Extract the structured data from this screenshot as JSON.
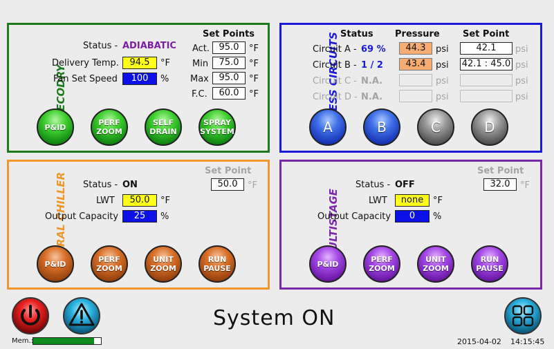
{
  "ecodry": {
    "title": "ECODRY",
    "status_label": "Status -",
    "status_value": "ADIABATIC",
    "set_points_header": "Set Points",
    "delivery_temp_label": "Delivery Temp.",
    "delivery_temp_value": "94.5",
    "fan_set_speed_label": "Fan Set Speed",
    "fan_set_speed_value": "100",
    "unit_f": "°F",
    "unit_pct": "%",
    "sp_act_label": "Act.",
    "sp_act_value": "95.0",
    "sp_min_label": "Min",
    "sp_min_value": "75.0",
    "sp_max_label": "Max",
    "sp_max_value": "95.0",
    "sp_fc_label": "F.C.",
    "sp_fc_value": "60.0",
    "buttons": [
      "P&ID",
      "PERF ZOOM",
      "SELF DRAIN",
      "SPRAY SYSTEM"
    ]
  },
  "process": {
    "title": "PROCESS CIRCUITS",
    "status_header": "Status",
    "pressure_header": "Pressure",
    "setpoint_header": "Set Point",
    "unit_psi": "psi",
    "circuits": [
      {
        "label": "Circuit A -",
        "status": "69 %",
        "pressure": "44.3",
        "setpoint": "42.1"
      },
      {
        "label": "Circuit B -",
        "status": "1 / 2",
        "pressure": "43.4",
        "setpoint": "42.1 : 45.0"
      },
      {
        "label": "Circuit C -",
        "status": "N.A.",
        "pressure": "",
        "setpoint": ""
      },
      {
        "label": "Circuit D -",
        "status": "N.A.",
        "pressure": "",
        "setpoint": ""
      }
    ],
    "buttons": [
      "A",
      "B",
      "C",
      "D"
    ]
  },
  "central_chiller": {
    "title": "CENTRAL CHILLER",
    "status_label": "Status -",
    "status_value": "ON",
    "setpoint_header": "Set Point",
    "setpoint_value": "50.0",
    "lwt_label": "LWT",
    "lwt_value": "50.0",
    "output_label": "Output Capacity",
    "output_value": "25",
    "unit_f": "°F",
    "unit_pct": "%",
    "buttons": [
      "P&ID",
      "PERF ZOOM",
      "UNIT ZOOM",
      "RUN PAUSE"
    ]
  },
  "multistage": {
    "title": "MULTISTAGE",
    "status_label": "Status -",
    "status_value": "OFF",
    "setpoint_header": "Set Point",
    "setpoint_value": "32.0",
    "lwt_label": "LWT",
    "lwt_value": "none",
    "output_label": "Output Capacity",
    "output_value": "0",
    "unit_f": "°F",
    "unit_pct": "%",
    "buttons": [
      "P&ID",
      "PERF ZOOM",
      "UNIT ZOOM",
      "RUN PAUSE"
    ]
  },
  "footer": {
    "system_status": "System ON",
    "mem_label": "Mem.:",
    "mem_fraction": 0.9,
    "date": "2015-04-02",
    "time": "14:15:45"
  },
  "colors": {
    "ecodry_border": "#1d7a1d",
    "process_border": "#1a1ad8",
    "chiller_border": "#f0962a",
    "multistage_border": "#7a2aa8",
    "adiabatic_text": "#7a1fa0",
    "circuit_status_text": "#1a1ad8"
  }
}
